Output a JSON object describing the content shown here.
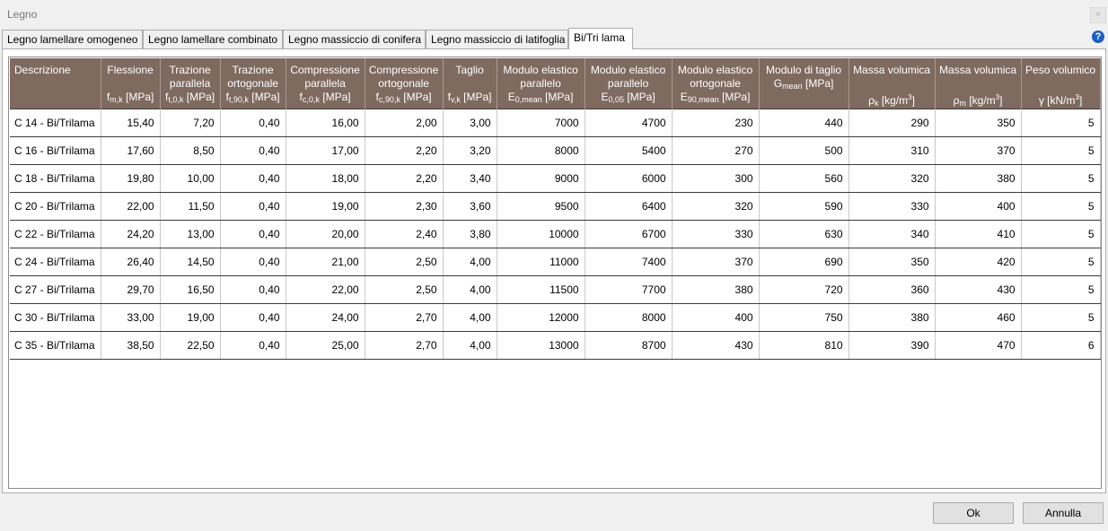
{
  "window": {
    "title": "Legno",
    "close": "×"
  },
  "tabs": [
    {
      "label": "Legno lamellare omogeneo"
    },
    {
      "label": "Legno lamellare combinato"
    },
    {
      "label": "Legno massiccio di conifera"
    },
    {
      "label": "Legno massiccio di latifoglia"
    },
    {
      "label": "Bi/Tri lama"
    }
  ],
  "help": "?",
  "columns": [
    {
      "title": "Descrizione",
      "sym": "",
      "sub": ""
    },
    {
      "title": "Flessione",
      "sym": "f",
      "sub": "m,k",
      "unit": " [MPa]"
    },
    {
      "title": "Trazione parallela",
      "sym": "f",
      "sub": "t,0,k",
      "unit": " [MPa]"
    },
    {
      "title": "Trazione ortogonale",
      "sym": "f",
      "sub": "t,90,k",
      "unit": " [MPa]"
    },
    {
      "title": "Compressione parallela",
      "sym": "f",
      "sub": "c,0,k",
      "unit": " [MPa]"
    },
    {
      "title": "Compressione ortogonale",
      "sym": "f",
      "sub": "c,90,k",
      "unit": " [MPa]"
    },
    {
      "title": "Taglio",
      "sym": "f",
      "sub": "v,k",
      "unit": " [MPa]"
    },
    {
      "title": "Modulo elastico parallelo",
      "sym": "E",
      "sub": "0,mean",
      "unit": " [MPa]"
    },
    {
      "title": "Modulo elastico parallelo",
      "sym": "E",
      "sub": "0,05",
      "unit": " [MPa]"
    },
    {
      "title": "Modulo elastico ortogonale",
      "sym": "E",
      "sub": "90,mean",
      "unit": " [MPa]"
    },
    {
      "title": "Modulo di taglio",
      "sym": "G",
      "sub": "mean",
      "unit": " [MPa]"
    },
    {
      "title": "Massa volumica",
      "sym": "ρ",
      "sub": "k",
      "unit": " [kg/m",
      "sup": "3",
      "unit_end": "]"
    },
    {
      "title": "Massa volumica",
      "sym": "ρ",
      "sub": "m",
      "unit": " [kg/m",
      "sup": "3",
      "unit_end": "]"
    },
    {
      "title": "Peso volumico",
      "sym": "γ",
      "sub": "",
      "unit": " [kN/m",
      "sup": "3",
      "unit_end": "]"
    }
  ],
  "rows": [
    [
      "C 14 - Bi/Trilama",
      "15,40",
      "7,20",
      "0,40",
      "16,00",
      "2,00",
      "3,00",
      "7000",
      "4700",
      "230",
      "440",
      "290",
      "350",
      "5"
    ],
    [
      "C 16 - Bi/Trilama",
      "17,60",
      "8,50",
      "0,40",
      "17,00",
      "2,20",
      "3,20",
      "8000",
      "5400",
      "270",
      "500",
      "310",
      "370",
      "5"
    ],
    [
      "C 18 - Bi/Trilama",
      "19,80",
      "10,00",
      "0,40",
      "18,00",
      "2,20",
      "3,40",
      "9000",
      "6000",
      "300",
      "560",
      "320",
      "380",
      "5"
    ],
    [
      "C 20 - Bi/Trilama",
      "22,00",
      "11,50",
      "0,40",
      "19,00",
      "2,30",
      "3,60",
      "9500",
      "6400",
      "320",
      "590",
      "330",
      "400",
      "5"
    ],
    [
      "C 22 - Bi/Trilama",
      "24,20",
      "13,00",
      "0,40",
      "20,00",
      "2,40",
      "3,80",
      "10000",
      "6700",
      "330",
      "630",
      "340",
      "410",
      "5"
    ],
    [
      "C 24 - Bi/Trilama",
      "26,40",
      "14,50",
      "0,40",
      "21,00",
      "2,50",
      "4,00",
      "11000",
      "7400",
      "370",
      "690",
      "350",
      "420",
      "5"
    ],
    [
      "C 27 - Bi/Trilama",
      "29,70",
      "16,50",
      "0,40",
      "22,00",
      "2,50",
      "4,00",
      "11500",
      "7700",
      "380",
      "720",
      "360",
      "430",
      "5"
    ],
    [
      "C 30 - Bi/Trilama",
      "33,00",
      "19,00",
      "0,40",
      "24,00",
      "2,70",
      "4,00",
      "12000",
      "8000",
      "400",
      "750",
      "380",
      "460",
      "5"
    ],
    [
      "C 35 - Bi/Trilama",
      "38,50",
      "22,50",
      "0,40",
      "25,00",
      "2,70",
      "4,00",
      "13000",
      "8700",
      "430",
      "810",
      "390",
      "470",
      "6"
    ]
  ],
  "buttons": {
    "ok": "Ok",
    "cancel": "Annulla"
  },
  "colors": {
    "header_bg": "#7e6a5f",
    "help_blue": "#1c5fc4"
  }
}
